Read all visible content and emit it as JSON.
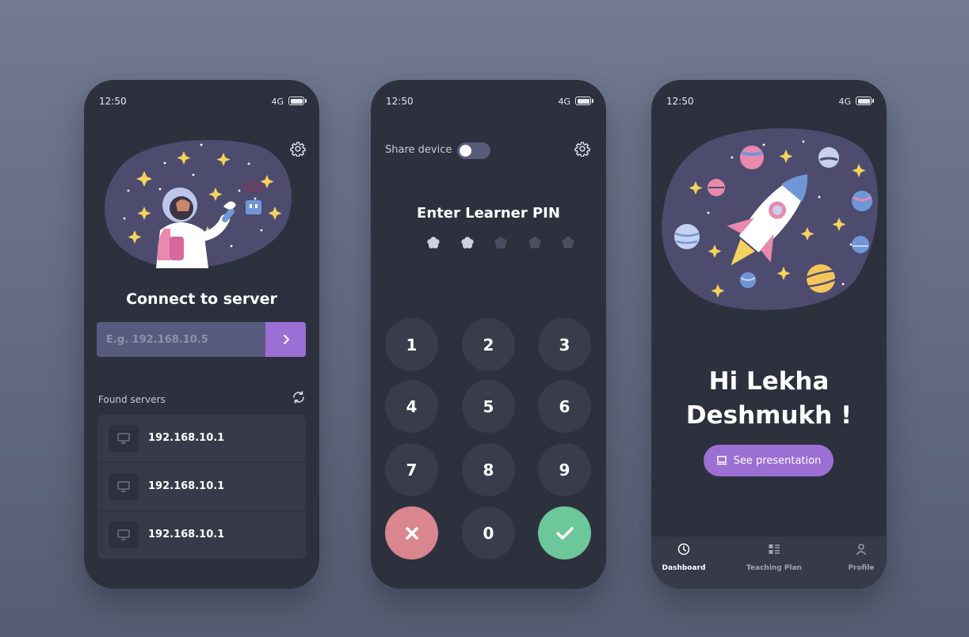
{
  "colors": {
    "background": "#6a7288",
    "phone": "#2d313e",
    "accent": "#9b6fd4",
    "cancel": "#d9868e",
    "confirm": "#6cc79b",
    "blob": "#4e4c6e",
    "star": "#f4d35e"
  },
  "status_bar": {
    "time": "12:50",
    "network": "4G"
  },
  "connect_screen": {
    "title": "Connect to server",
    "input_placeholder": "E.g. 192.168.10.5",
    "submit_icon": "chevron-right-icon",
    "found_label": "Found servers",
    "servers": [
      {
        "ip": "192.168.10.1"
      },
      {
        "ip": "192.168.10.1"
      },
      {
        "ip": "192.168.10.1"
      }
    ]
  },
  "pin_screen": {
    "share_label": "Share device",
    "share_enabled": false,
    "title": "Enter Learner PIN",
    "pin_length": 5,
    "pin_filled": 2,
    "keys": [
      "1",
      "2",
      "3",
      "4",
      "5",
      "6",
      "7",
      "8",
      "9",
      "cancel",
      "0",
      "confirm"
    ]
  },
  "dashboard_screen": {
    "greeting_line1": "Hi Lekha",
    "greeting_line2": "Deshmukh !",
    "presentation_button": "See presentation",
    "nav": [
      {
        "label": "Dashboard",
        "icon": "dashboard-icon",
        "active": true
      },
      {
        "label": "Teaching Plan",
        "icon": "teaching-plan-icon",
        "active": false
      },
      {
        "label": "Profile",
        "icon": "profile-icon",
        "active": false
      }
    ]
  }
}
